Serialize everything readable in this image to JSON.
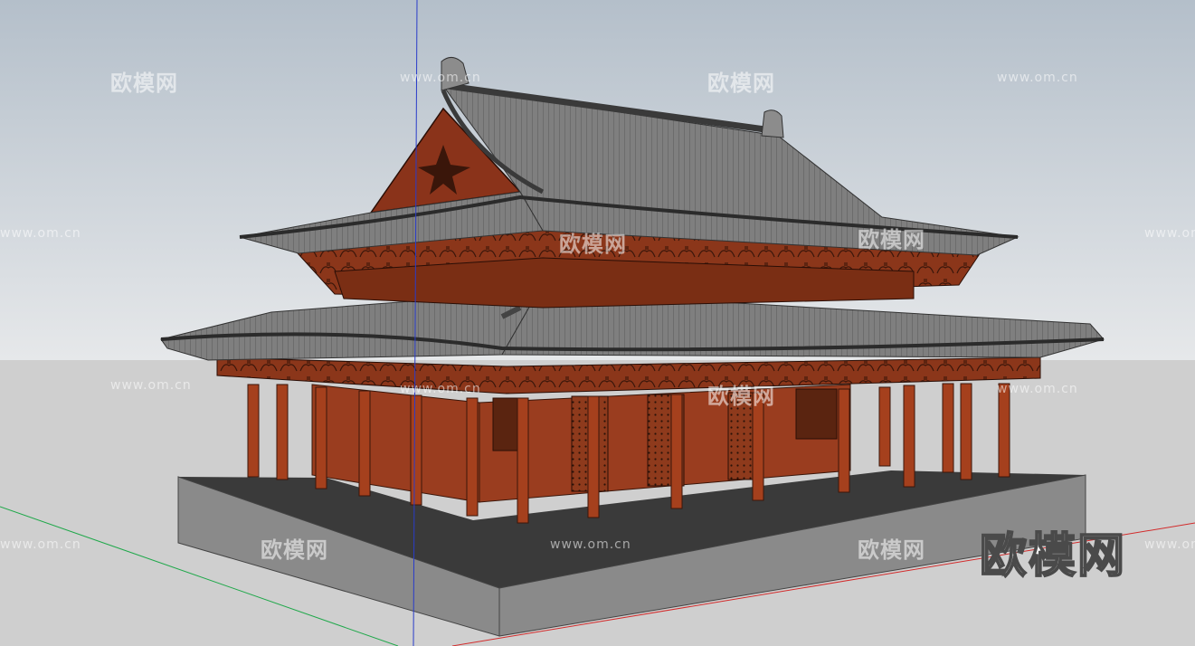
{
  "viewport": {
    "sky_top_color": "#b4bfca",
    "sky_bottom_color": "#e6e8ea",
    "ground_color": "#cfcfcf",
    "axis_colors": {
      "red": "#d22b2b",
      "green": "#1fa84a",
      "blue": "#2a3cc9"
    }
  },
  "model": {
    "roof_color": "#7f7f7f",
    "roof_dark_color": "#555555",
    "wood_color": "#9a3d1f",
    "column_color": "#a5401d",
    "platform_top_color": "#3a3a3a",
    "platform_side_color": "#8a8a8a"
  },
  "watermarks": [
    {
      "text": "欧模网",
      "kind": "cn"
    },
    {
      "text": "欧模网",
      "kind": "cn"
    },
    {
      "text": "www.om.cn",
      "kind": "url"
    },
    {
      "text": "www.om.cn",
      "kind": "url"
    },
    {
      "text": "欧模网",
      "kind": "cn"
    },
    {
      "text": "www.om.cn",
      "kind": "url"
    },
    {
      "text": "欧模网",
      "kind": "cn"
    },
    {
      "text": "www.om.cn",
      "kind": "url"
    },
    {
      "text": "www.om.cn",
      "kind": "url"
    },
    {
      "text": "欧模网",
      "kind": "cn"
    },
    {
      "text": "www.om.cn",
      "kind": "url"
    },
    {
      "text": "www.om.cn",
      "kind": "url"
    },
    {
      "text": "欧模网",
      "kind": "cn"
    },
    {
      "text": "www.om.cn",
      "kind": "url"
    },
    {
      "text": "欧模网",
      "kind": "cn"
    },
    {
      "text": "www.om.cn",
      "kind": "url"
    },
    {
      "text": "www.om.cn",
      "kind": "url"
    }
  ],
  "logo_text": "欧模网"
}
